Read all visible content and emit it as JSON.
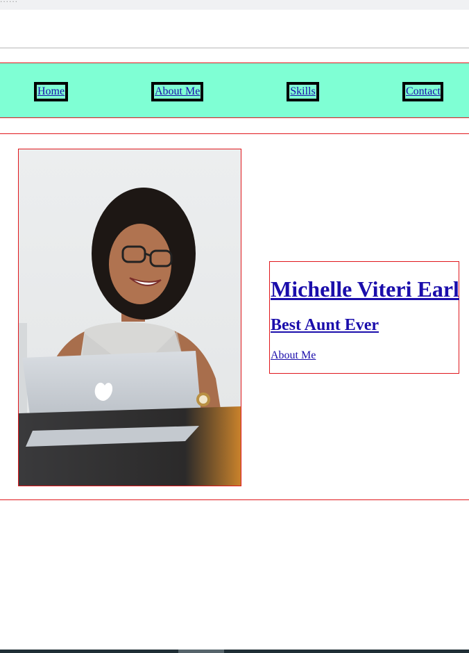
{
  "nav": {
    "items": [
      {
        "label": "Home"
      },
      {
        "label": "About Me"
      },
      {
        "label": "Skills"
      },
      {
        "label": "Contact"
      }
    ]
  },
  "hero": {
    "name": "Michelle Viteri Earl",
    "tagline": "Best Aunt Ever",
    "link_label": "About Me"
  },
  "colors": {
    "nav_background": "#7fffd4",
    "border_accent": "#e0161b",
    "link": "#1a0dab",
    "nav_button_border": "#000000",
    "bottom_bar": "#1f2e35"
  },
  "icons": {
    "photo": "profile-photo"
  }
}
